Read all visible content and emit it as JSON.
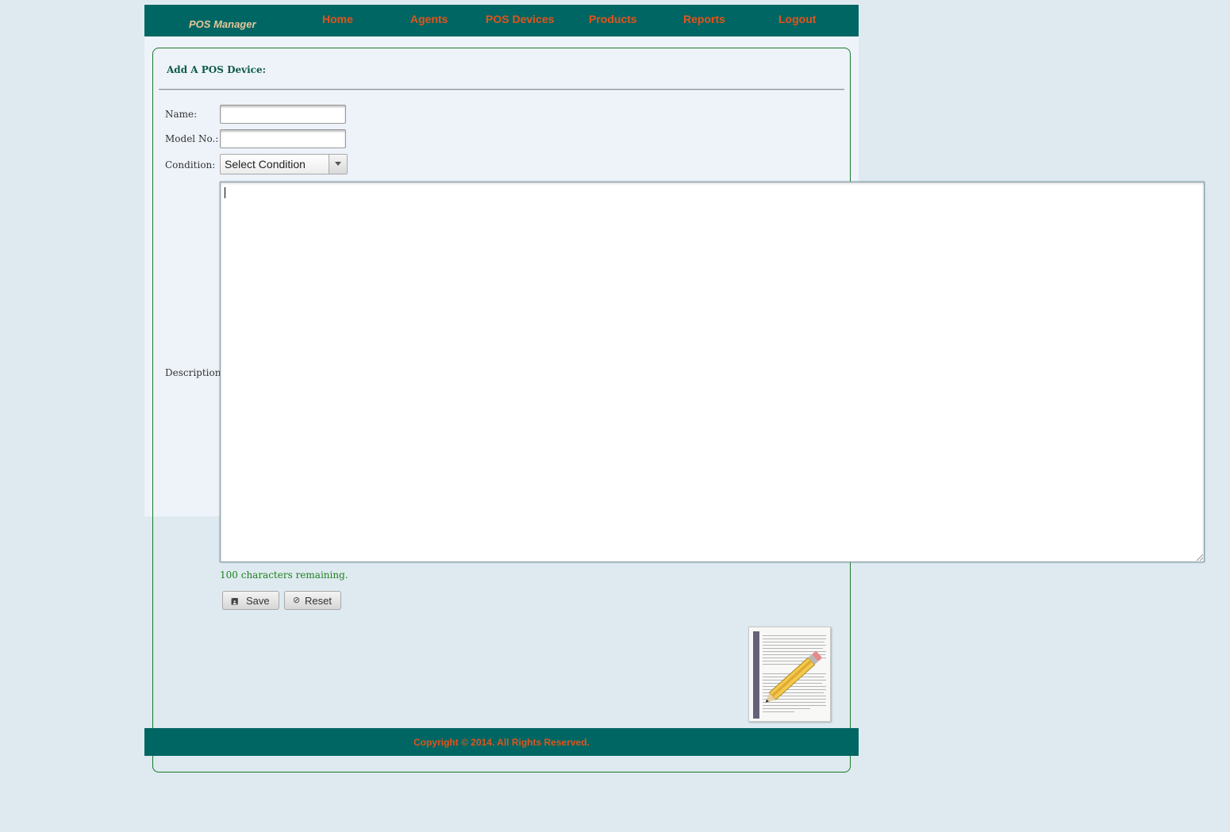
{
  "header": {
    "brand": "POS Manager",
    "nav": [
      {
        "label": "Home"
      },
      {
        "label": "Agents"
      },
      {
        "label": "POS Devices"
      },
      {
        "label": "Products"
      },
      {
        "label": "Reports"
      },
      {
        "label": "Logout"
      }
    ]
  },
  "form": {
    "heading": "Add A POS Device:",
    "name_label": "Name:",
    "name_value": "",
    "model_label": "Model No.:",
    "model_value": "",
    "condition_label": "Condition:",
    "condition_selected": "Select Condition",
    "description_label": "Description:",
    "description_value": "",
    "remaining_text": "100 characters remaining.",
    "save_label": "Save",
    "reset_label": "Reset"
  },
  "footer": {
    "copyright": "Copyright © 2014. All Rights Reserved."
  },
  "colors": {
    "header_bg": "#006663",
    "nav_text": "#e2531b",
    "brand_text": "#e6c79a",
    "page_bg": "#deeaf0",
    "remaining_text": "#208020"
  },
  "icons": [
    "floppy-disk-icon",
    "cancel-circle-icon",
    "document-pencil-image"
  ]
}
